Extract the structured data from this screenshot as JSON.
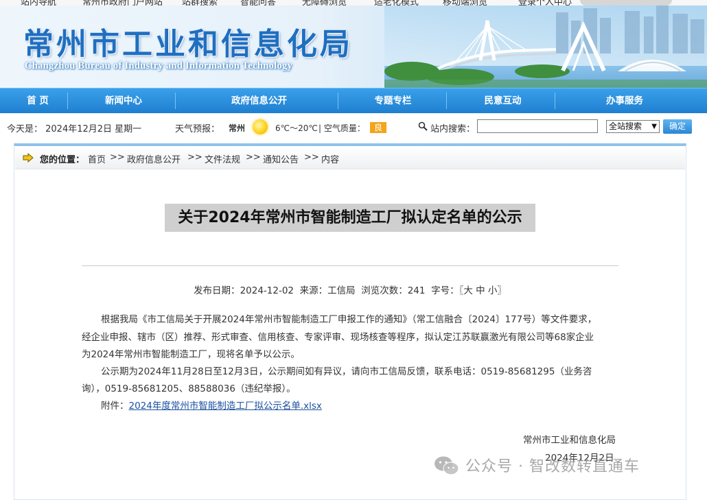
{
  "top_strip": {
    "items": [
      "站内导航",
      "常州市政府门户网站",
      "站群搜索",
      "智能问答",
      "无障碍浏览",
      "适老化模式",
      "移动端浏览",
      "登录个人中心"
    ]
  },
  "header": {
    "title": "常州市工业和信息化局",
    "subtitle": "Changzhou Bureau of Industry and Information Technology"
  },
  "nav": {
    "items": [
      "首 页",
      "新闻中心",
      "政府信息公开",
      "专题专栏",
      "民意互动",
      "办事服务"
    ]
  },
  "info_bar": {
    "date_text": "今天是： 2024年12月2日  星期一",
    "weather_label": "天气预报：",
    "city": "常州",
    "temperature": "6℃～20℃",
    "air_label": "| 空气质量：",
    "air_quality": "良",
    "search_label": "站内搜索：",
    "search_value": "",
    "scope_selected": "全站搜索",
    "search_button": "确定"
  },
  "breadcrumb": {
    "label": "您的位置：",
    "items": [
      "首页",
      "政府信息公开",
      "文件法规",
      "通知公告",
      "内容"
    ],
    "separator": ">>"
  },
  "article": {
    "title": "关于2024年常州市智能制造工厂拟认定名单的公示",
    "meta": {
      "date_label": "发布日期：",
      "date": "2024-12-02",
      "source_label": "来源：",
      "source": "工信局",
      "views_label": "浏览次数：",
      "views": "241",
      "font_label": "字号：",
      "font_options": "〖大 中 小〗"
    },
    "paragraphs": [
      "根据我局《市工信局关于开展2024年常州市智能制造工厂申报工作的通知》（常工信融合〔2024〕177号）等文件要求，",
      "经企业申报、辖市（区）推荐、形式审查、信用核查、专家评审、现场核查等程序，拟认定江苏联赢激光有限公司等68家企业",
      "为2024年常州市智能制造工厂，现将名单予以公示。",
      "公示期为2024年11月28日至12月3日，公示期间如有异议，请向市工信局反馈，联系电话：0519-85681295（业务咨",
      "询），0519-85681205、88588036（违纪举报）。"
    ],
    "attachment_label": "附件：",
    "attachment_link": "2024年度常州市智能制造工厂拟公示名单.xlsx",
    "signature_org": "常州市工业和信息化局",
    "signature_date": "2024年12月2日"
  },
  "watermark": {
    "text": "公众号 · 智改数转直通车"
  },
  "colors": {
    "nav_blue": "#2b8ddb",
    "title_blue": "#1f6fc0",
    "link_blue": "#1a4fa0",
    "aqi_orange": "#f3a51b"
  }
}
